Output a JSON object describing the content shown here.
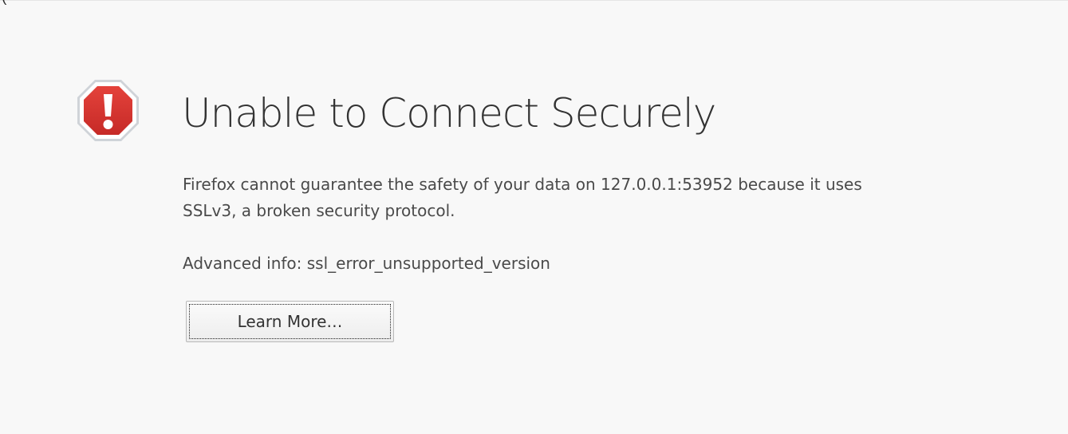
{
  "colors": {
    "page_background": "#f8f8f8",
    "icon_red": "#d7352f",
    "title_text": "#333333",
    "body_text": "#4a4a4a"
  },
  "icon": {
    "name": "error-octagon-icon"
  },
  "top_fragment": "(",
  "error_page": {
    "title": "Unable to Connect Securely",
    "description": "Firefox cannot guarantee the safety of your data on 127.0.0.1:53952 because it uses SSLv3, a broken security protocol.",
    "advanced_info": "Advanced info: ssl_error_unsupported_version",
    "learn_more_label": "Learn More…"
  }
}
